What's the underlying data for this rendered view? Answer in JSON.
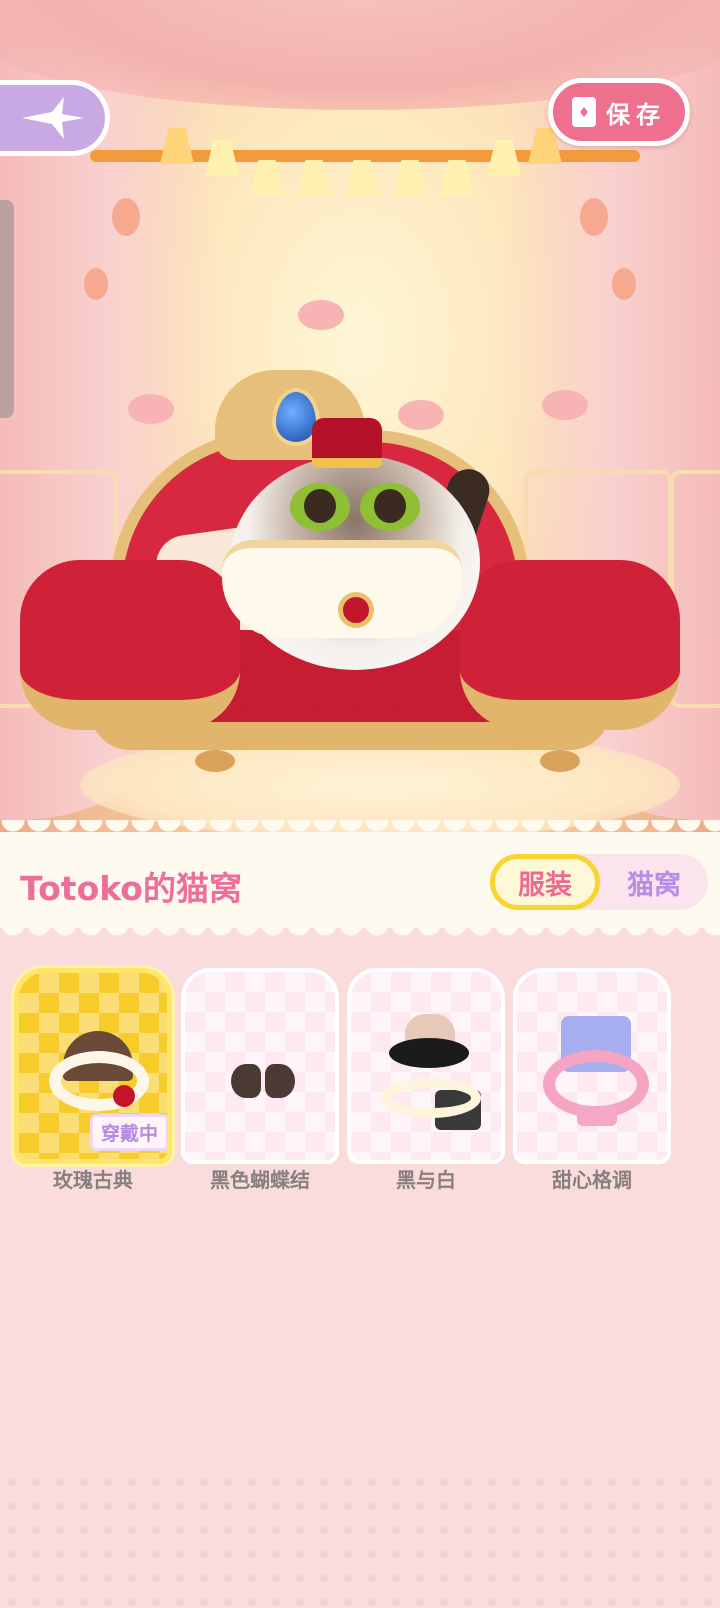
{
  "header": {
    "save_label": "保存"
  },
  "panel": {
    "title": "Totoko的猫窝",
    "tabs": [
      {
        "label": "服装",
        "active": true
      },
      {
        "label": "猫窝",
        "active": false
      }
    ]
  },
  "items": [
    {
      "name": "玫瑰古典",
      "selected": true,
      "badge": "穿戴中",
      "icon": "rose-classic-outfit-icon"
    },
    {
      "name": "黑色蝴蝶结",
      "selected": false,
      "icon": "black-bow-icon"
    },
    {
      "name": "黑与白",
      "selected": false,
      "icon": "black-and-white-outfit-icon"
    },
    {
      "name": "甜心格调",
      "selected": false,
      "icon": "sweetheart-outfit-icon"
    }
  ],
  "colors": {
    "accent_pink": "#ec6f9a",
    "save_button": "#ef6f8f",
    "selected_card": "#f7cb2a",
    "tab_inactive": "#b58ee6",
    "back_button": "#c9a9e3"
  }
}
